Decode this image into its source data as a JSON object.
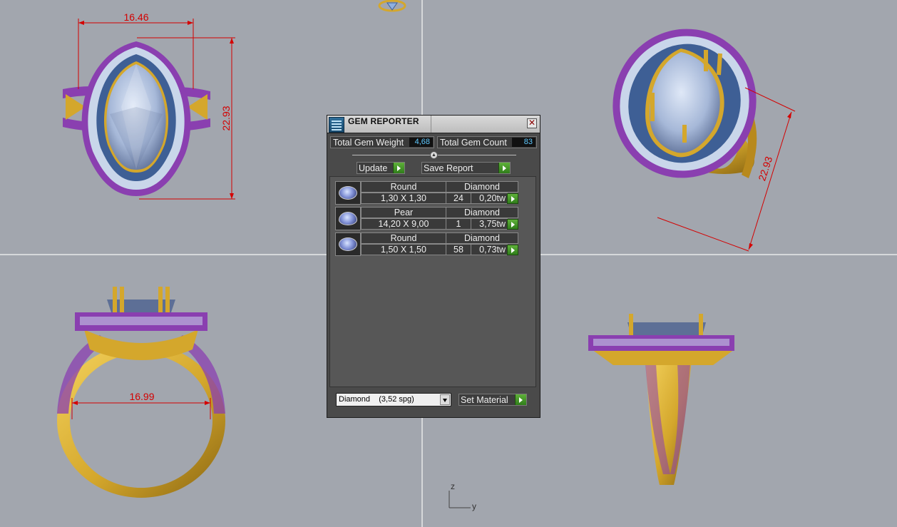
{
  "viewport": {
    "dimensions": {
      "top_width": "16.46",
      "top_height": "22.93",
      "perspective_height": "22.93",
      "ring_inner_diameter": "16.99"
    },
    "axes": {
      "vertical": "z",
      "horizontal": "y"
    }
  },
  "gem_reporter": {
    "title": "GEM REPORTER",
    "total_weight_label": "Total Gem Weight",
    "total_weight_value": "4,68",
    "total_count_label": "Total Gem Count",
    "total_count_value": "83",
    "update_label": "Update",
    "save_report_label": "Save Report",
    "gems": [
      {
        "shape": "Round",
        "material": "Diamond",
        "size": "1,30 X 1,30",
        "count": "24",
        "weight": "0,20tw"
      },
      {
        "shape": "Pear",
        "material": "Diamond",
        "size": "14,20 X 9,00",
        "count": "1",
        "weight": "3,75tw"
      },
      {
        "shape": "Round",
        "material": "Diamond",
        "size": "1,50 X 1,50",
        "count": "58",
        "weight": "0,73tw"
      }
    ],
    "material_select": "Diamond    (3,52 spg)",
    "set_material_label": "Set Material"
  },
  "colors": {
    "background": "#a2a6ae",
    "gold": "#d4a72c",
    "gem_blue": "#9fb3d6",
    "prong_purple": "#8a3fb0",
    "dimension_red": "#d40000",
    "value_cyan": "#5fc9ff"
  }
}
